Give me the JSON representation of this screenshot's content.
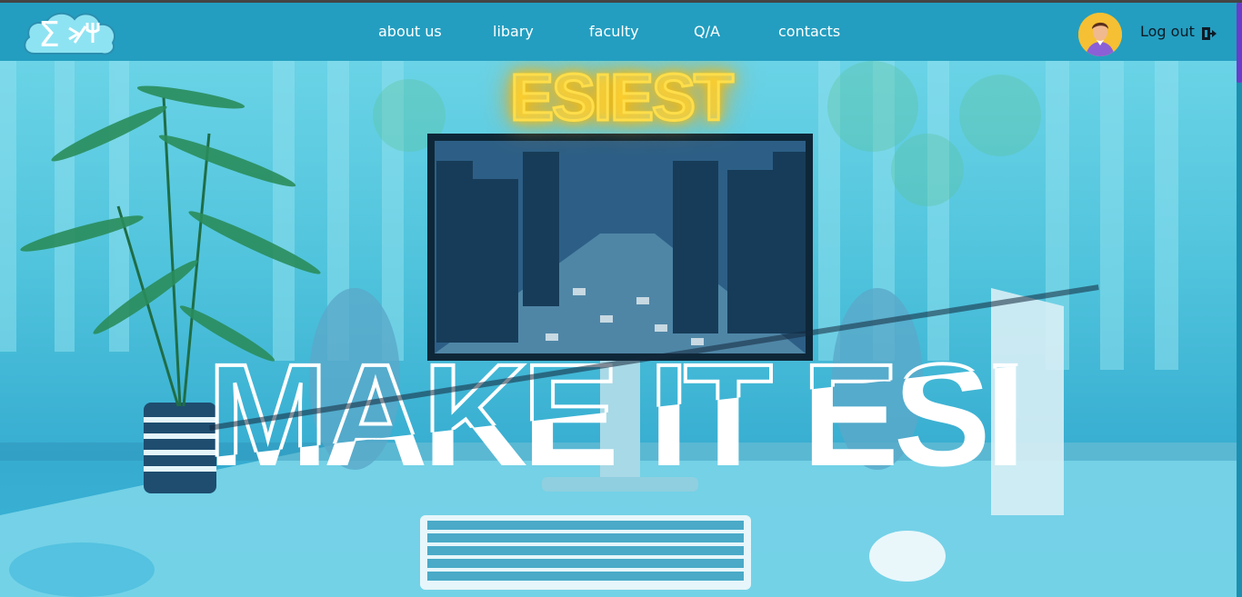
{
  "nav": {
    "items": [
      {
        "label": "about us"
      },
      {
        "label": "libary"
      },
      {
        "label": "faculty"
      },
      {
        "label": "Q/A"
      },
      {
        "label": "contacts"
      }
    ],
    "logout_label": "Log out"
  },
  "hero": {
    "neon_title": "ESIEST",
    "slogan": "MAKE IT ESI"
  },
  "colors": {
    "navbar": "#239ec0",
    "hero_tint": "#4fc3dc",
    "neon": "#ffde4a",
    "scroll_thumb": "#6a3cc9"
  },
  "icons": [
    "sigma-logo-icon",
    "avatar-icon",
    "logout-icon"
  ]
}
